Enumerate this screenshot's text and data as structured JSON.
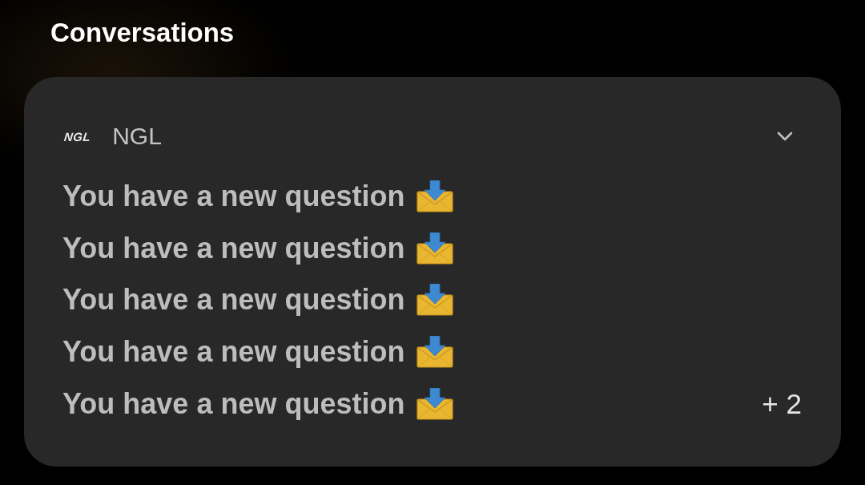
{
  "header": {
    "title": "Conversations"
  },
  "notification": {
    "app": {
      "logo": "NGL",
      "name": "NGL"
    },
    "messages": [
      {
        "text": "You have a new question"
      },
      {
        "text": "You have a new question"
      },
      {
        "text": "You have a new question"
      },
      {
        "text": "You have a new question"
      },
      {
        "text": "You have a new question"
      }
    ],
    "more_count": "+ 2"
  }
}
